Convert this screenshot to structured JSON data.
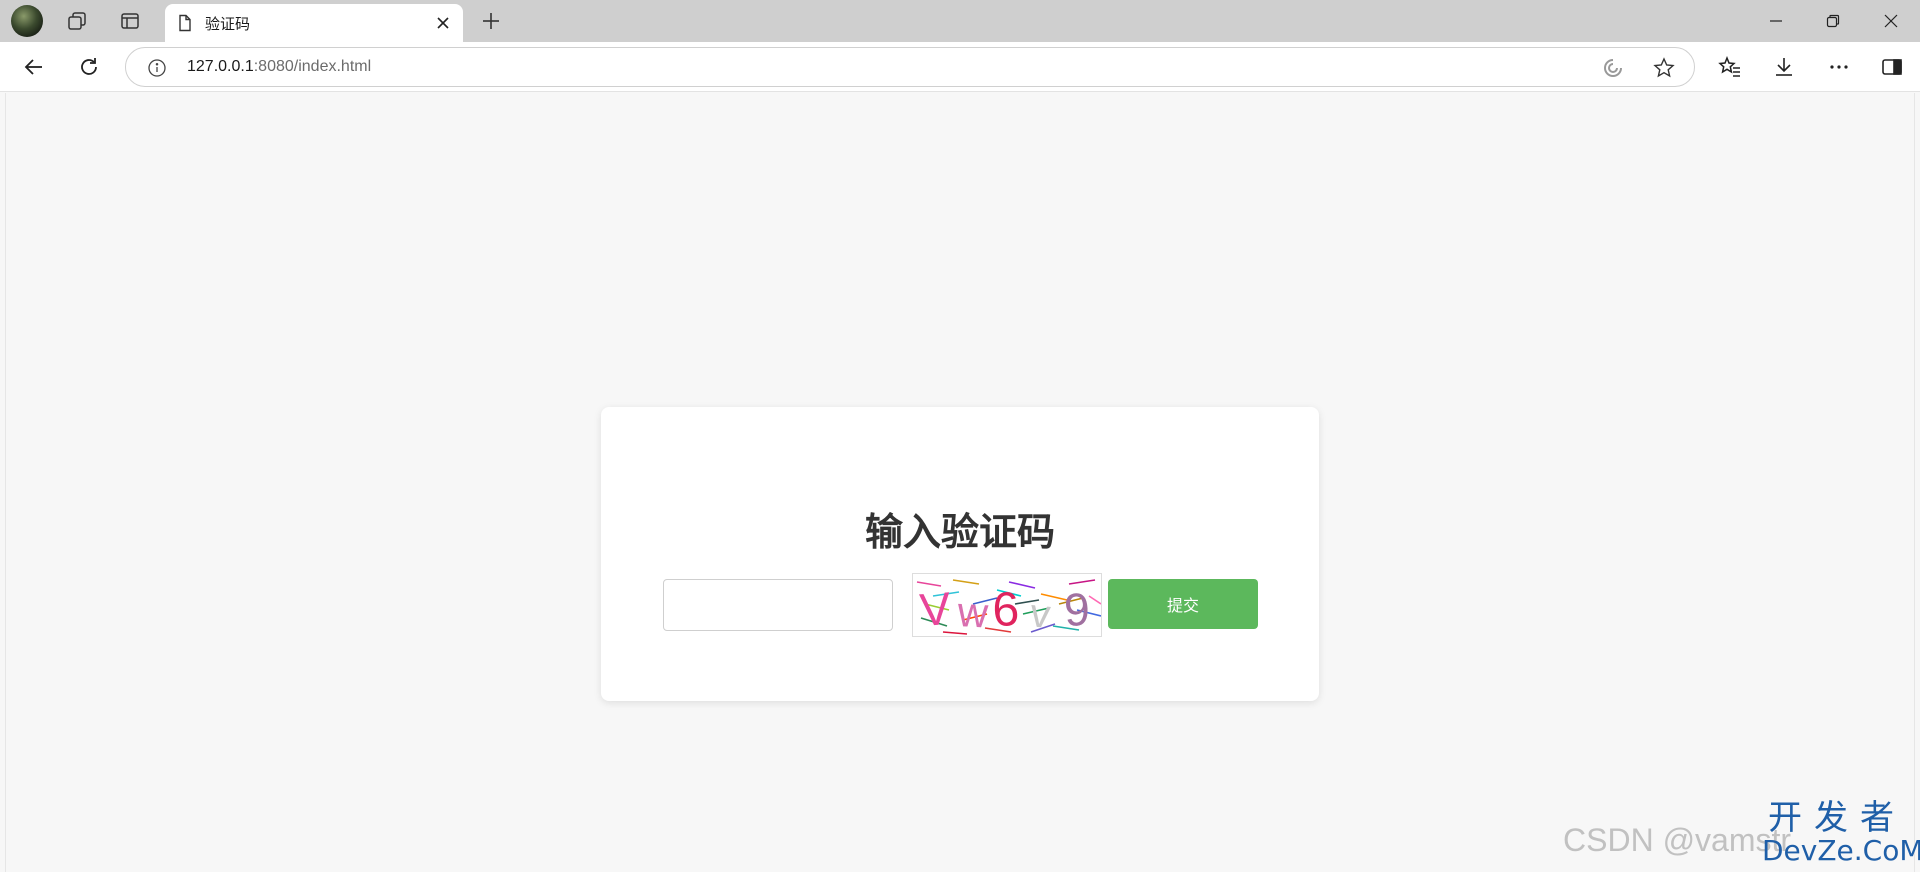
{
  "browser": {
    "tab": {
      "title": "验证码"
    },
    "address": {
      "host": "127.0.0.1",
      "rest": ":8080/index.html"
    }
  },
  "page": {
    "title": "输入验证码",
    "input_value": "",
    "captcha_text": "Vw6v9",
    "submit_label": "提交"
  },
  "watermark": {
    "csdn": "CSDN @vamstr",
    "devze_top": "开发者",
    "devze_bottom": "DevZe.CoM"
  },
  "colors": {
    "submit": "#5cb85c",
    "page_bg": "#f7f7f7",
    "tabstrip": "#cfcfcf"
  }
}
